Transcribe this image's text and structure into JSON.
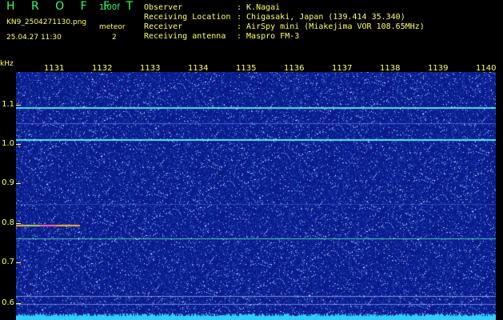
{
  "header": {
    "app_title": "H R O F F T",
    "version": "1.00f",
    "filename": "KN9_2504271130.png",
    "meteor_label": "meteor",
    "timestamp": "25.04.27 11:30",
    "meteor_count": "2",
    "info": [
      {
        "label": "Observer",
        "value": ": K.Nagai"
      },
      {
        "label": "Receiving Location",
        "value": ": Chigasaki, Japan (139.414 35.340)"
      },
      {
        "label": "Receiver",
        "value": ": AirSpy mini (Miakejima VOR 108.65MHz)"
      },
      {
        "label": "Receiving antenna",
        "value": ": Maspro FM-3"
      }
    ]
  },
  "axes": {
    "y_unit": "kHz",
    "y_labels": [
      "1.1",
      "1.0",
      "0.9",
      "0.8",
      "0.7",
      "0.6"
    ],
    "x_labels": [
      "1131",
      "1132",
      "1133",
      "1134",
      "1135",
      "1136",
      "1137",
      "1138",
      "1139",
      "1140"
    ]
  },
  "colors": {
    "background": "#000000",
    "spectrogram_bg": "#0a1a8a",
    "label_color": "#ffff66",
    "title_color": "#33ff66",
    "signal_line": "#66ffff"
  }
}
